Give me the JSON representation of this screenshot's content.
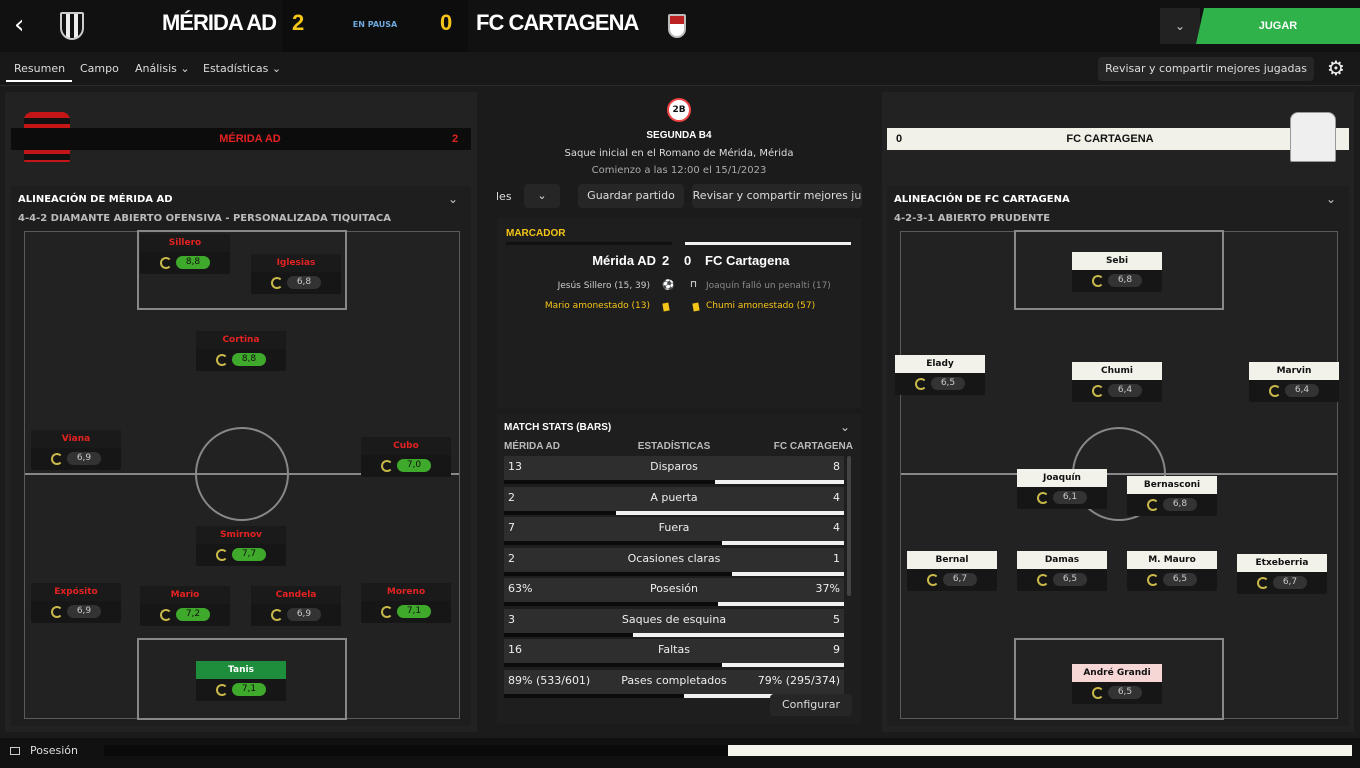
{
  "header": {
    "home_name": "MÉRIDA AD",
    "home_score": "2",
    "status": "EN PAUSA",
    "away_score": "0",
    "away_name": "FC CARTAGENA",
    "play_label": "JUGAR",
    "dropdown_icon": "⌄",
    "back_icon": "‹"
  },
  "tabs": [
    {
      "label": "Resumen"
    },
    {
      "label": "Campo"
    },
    {
      "label": "Análisis ⌄"
    },
    {
      "label": "Estadísticas ⌄"
    }
  ],
  "review_label": "Revisar y compartir mejores jugadas",
  "home_banner": {
    "name": "MÉRIDA AD",
    "score": "2"
  },
  "away_banner": {
    "name": "FC CARTAGENA",
    "score": "0"
  },
  "center": {
    "competition": "SEGUNDA B4",
    "kickoff": "Saque inicial en el Romano de Mérida, Mérida",
    "start": "Comienzo a las 12:00 el 15/1/2023",
    "partial_label": "les",
    "save_label": "Guardar partido",
    "review_label": "Revisar y compartir mejores ju",
    "logo_text": "2B"
  },
  "marcador": {
    "title": "MARCADOR",
    "home": "Mérida AD",
    "home_score": "2",
    "away_score": "0",
    "away": "FC Cartagena",
    "ev1_left": "Jesús Sillero (15, 39)",
    "ev1_right": "Joaquín falló un penalti (17)",
    "ev2_left": "Mario amonestado (13)",
    "ev2_right": "Chumi amonestado (57)"
  },
  "stats": {
    "title": "MATCH STATS (BARS)",
    "col_home": "MÉRIDA AD",
    "col_mid": "ESTADÍSTICAS",
    "col_away": "FC CARTAGENA",
    "rows": [
      {
        "home": "13",
        "label": "Disparos",
        "away": "8",
        "home_frac": 0.62,
        "away_frac": 0.38
      },
      {
        "home": "2",
        "label": "A puerta",
        "away": "4",
        "home_frac": 0.33,
        "away_frac": 0.67
      },
      {
        "home": "7",
        "label": "Fuera",
        "away": "4",
        "home_frac": 0.64,
        "away_frac": 0.36
      },
      {
        "home": "2",
        "label": "Ocasiones claras",
        "away": "1",
        "home_frac": 0.67,
        "away_frac": 0.33
      },
      {
        "home": "63%",
        "label": "Posesión",
        "away": "37%",
        "home_frac": 0.63,
        "away_frac": 0.37
      },
      {
        "home": "3",
        "label": "Saques de esquina",
        "away": "5",
        "home_frac": 0.38,
        "away_frac": 0.62
      },
      {
        "home": "16",
        "label": "Faltas",
        "away": "9",
        "home_frac": 0.64,
        "away_frac": 0.36
      },
      {
        "home": "89% (533/601)",
        "label": "Pases completados",
        "away": "79% (295/374)",
        "home_frac": 0.53,
        "away_frac": 0.47
      }
    ],
    "config_label": "Configurar"
  },
  "home_lineup": {
    "title": "ALINEACIÓN DE MÉRIDA AD",
    "formation": "4-4-2 DIAMANTE ABIERTO OFENSIVA - PERSONALIZADA TIQUITACA",
    "players": [
      {
        "name": "Sillero",
        "rating": "8,8",
        "good": true
      },
      {
        "name": "Iglesias",
        "rating": "6,8",
        "good": false
      },
      {
        "name": "Cortina",
        "rating": "8,8",
        "good": true
      },
      {
        "name": "Viana",
        "rating": "6,9",
        "good": false
      },
      {
        "name": "Cubo",
        "rating": "7,0",
        "good": true
      },
      {
        "name": "Smirnov",
        "rating": "7,7",
        "good": true
      },
      {
        "name": "Expósito",
        "rating": "6,9",
        "good": false
      },
      {
        "name": "Mario",
        "rating": "7,2",
        "good": true
      },
      {
        "name": "Candela",
        "rating": "6,9",
        "good": false
      },
      {
        "name": "Moreno",
        "rating": "7,1",
        "good": true
      },
      {
        "name": "Tanis",
        "rating": "7,1",
        "good": true
      }
    ]
  },
  "away_lineup": {
    "title": "ALINEACIÓN DE FC CARTAGENA",
    "formation": "4-2-3-1 ABIERTO PRUDENTE",
    "players": [
      {
        "name": "Sebi",
        "rating": "6,8"
      },
      {
        "name": "Elady",
        "rating": "6,5"
      },
      {
        "name": "Chumi",
        "rating": "6,4"
      },
      {
        "name": "Marvin",
        "rating": "6,4"
      },
      {
        "name": "Joaquín",
        "rating": "6,1"
      },
      {
        "name": "Bernasconi",
        "rating": "6,8"
      },
      {
        "name": "Bernal",
        "rating": "6,7"
      },
      {
        "name": "Damas",
        "rating": "6,5"
      },
      {
        "name": "M. Mauro",
        "rating": "6,5"
      },
      {
        "name": "Etxeberria",
        "rating": "6,7"
      },
      {
        "name": "André Grandi",
        "rating": "6,5"
      }
    ]
  },
  "possession": {
    "label": "Posesión",
    "home_frac": 0.5,
    "away_frac": 0.5
  },
  "colors": {
    "accent": "#2fb24a",
    "home_red": "#e52222",
    "score_yellow": "#f5c518"
  }
}
